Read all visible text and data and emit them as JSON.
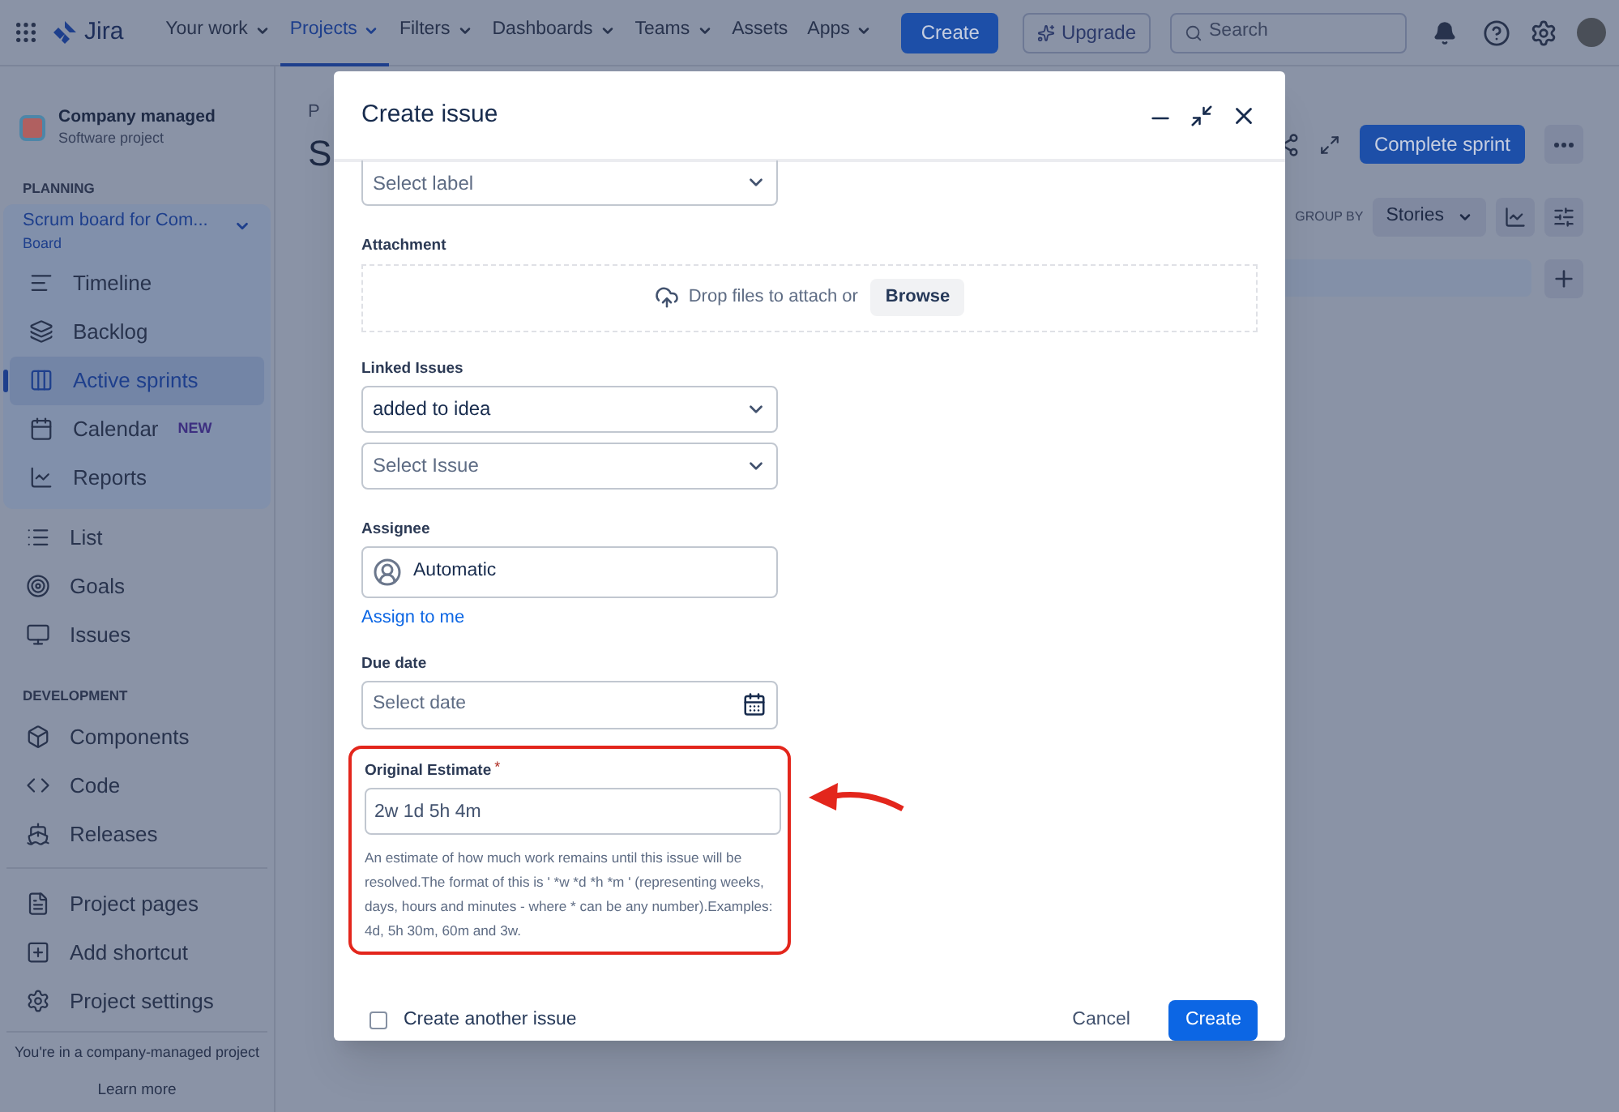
{
  "top_nav": {
    "product": "Jira",
    "items": [
      {
        "label": "Your work",
        "selected": false,
        "has_menu": true
      },
      {
        "label": "Projects",
        "selected": true,
        "has_menu": true
      },
      {
        "label": "Filters",
        "selected": false,
        "has_menu": true
      },
      {
        "label": "Dashboards",
        "selected": false,
        "has_menu": true
      },
      {
        "label": "Teams",
        "selected": false,
        "has_menu": true
      },
      {
        "label": "Assets",
        "selected": false,
        "has_menu": false
      },
      {
        "label": "Apps",
        "selected": false,
        "has_menu": true
      }
    ],
    "create_button": "Create",
    "upgrade_button": "Upgrade",
    "search": {
      "placeholder": "Search"
    }
  },
  "sidebar": {
    "project": {
      "name": "Company managed",
      "type": "Software project"
    },
    "planning": {
      "heading": "PLANNING",
      "board": {
        "title": "Scrum board for Com...",
        "subtitle": "Board"
      },
      "items": [
        {
          "label": "Timeline",
          "selected": false
        },
        {
          "label": "Backlog",
          "selected": false
        },
        {
          "label": "Active sprints",
          "selected": true
        },
        {
          "label": "Calendar",
          "selected": false,
          "badge": "NEW"
        },
        {
          "label": "Reports",
          "selected": false
        }
      ]
    },
    "items": [
      {
        "label": "List"
      },
      {
        "label": "Goals"
      },
      {
        "label": "Issues"
      }
    ],
    "development": {
      "heading": "DEVELOPMENT",
      "items": [
        {
          "label": "Components"
        },
        {
          "label": "Code"
        },
        {
          "label": "Releases"
        }
      ]
    },
    "bottom_items": [
      {
        "label": "Project pages"
      },
      {
        "label": "Add shortcut"
      },
      {
        "label": "Project settings"
      }
    ],
    "footer": {
      "text": "You're in a company-managed project",
      "link": "Learn more"
    }
  },
  "board": {
    "breadcrumb": "P",
    "title": "S",
    "complete_button": "Complete sprint",
    "group_by_label": "GROUP BY",
    "group_by_value": "Stories"
  },
  "dialog": {
    "title": "Create issue",
    "label_field": {
      "placeholder": "Select label"
    },
    "attachment": {
      "label": "Attachment",
      "text": "Drop files to attach or",
      "button": "Browse"
    },
    "linked_issues": {
      "label": "Linked Issues",
      "relation": "added to idea",
      "issue_placeholder": "Select Issue"
    },
    "assignee": {
      "label": "Assignee",
      "value": "Automatic",
      "link": "Assign to me"
    },
    "due_date": {
      "label": "Due date",
      "placeholder": "Select date"
    },
    "original_estimate": {
      "label": "Original Estimate",
      "required_mark": "*",
      "highlighted": true,
      "value": "2w 1d 5h 4m",
      "help": "An estimate of how much work remains until this issue will be resolved.The format of this is ' *w *d *h *m ' (representing weeks, days, hours and minutes - where * can be any number).Examples: 4d, 5h 30m, 60m and 3w."
    },
    "create_another": {
      "label": "Create another issue",
      "checked": false
    },
    "cancel_button": "Cancel",
    "create_button": "Create"
  }
}
